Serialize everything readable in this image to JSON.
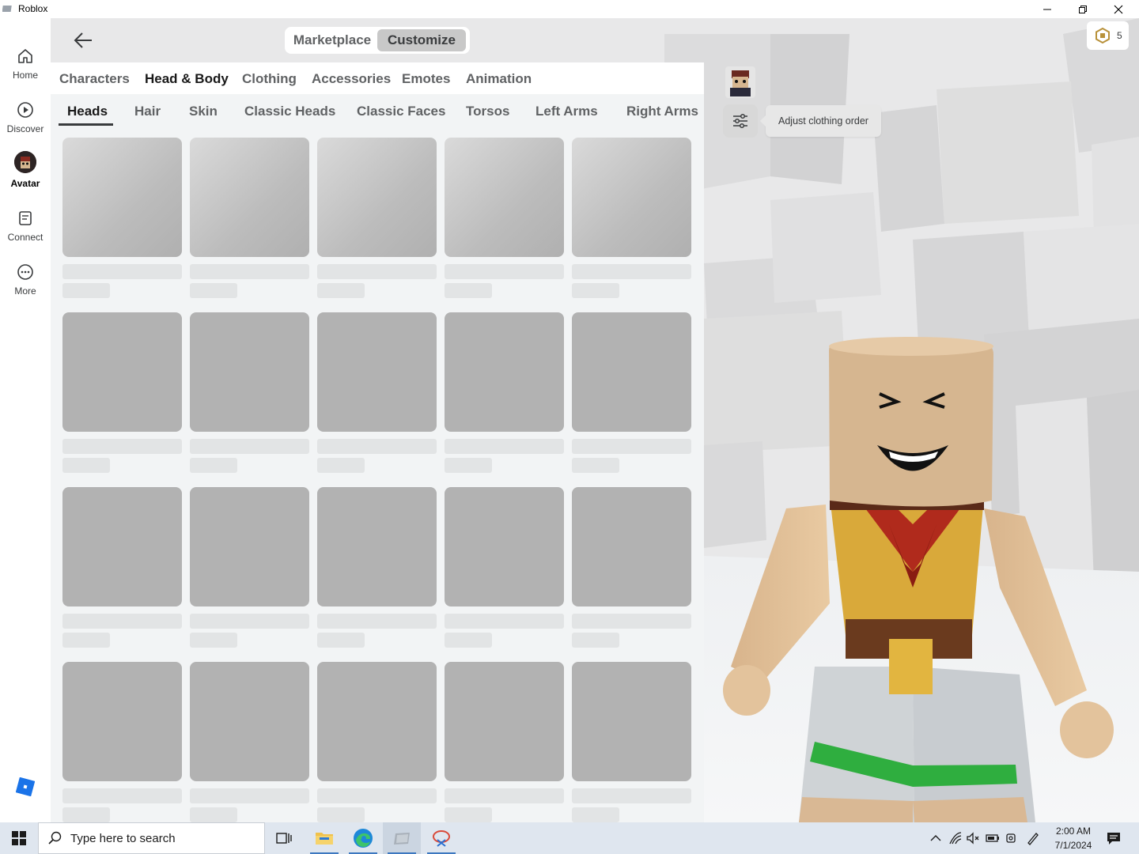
{
  "window": {
    "title": "Roblox"
  },
  "nav": {
    "items": [
      {
        "label": "Home",
        "icon": "home-icon"
      },
      {
        "label": "Discover",
        "icon": "play-icon"
      },
      {
        "label": "Avatar",
        "icon": "avatar-icon",
        "active": true
      },
      {
        "label": "Connect",
        "icon": "chat-icon"
      },
      {
        "label": "More",
        "icon": "more-icon"
      }
    ]
  },
  "header": {
    "segment": {
      "marketplace": "Marketplace",
      "customize": "Customize"
    }
  },
  "tabs": {
    "categories": [
      "Characters",
      "Head & Body",
      "Clothing",
      "Accessories",
      "Emotes",
      "Animation"
    ],
    "active_category": "Head & Body",
    "subcategories": [
      "Heads",
      "Hair",
      "Skin",
      "Classic Heads",
      "Classic Faces",
      "Torsos",
      "Left Arms",
      "Right Arms"
    ],
    "active_subcategory": "Heads"
  },
  "tooltip": {
    "text": "Adjust clothing order"
  },
  "robux": {
    "balance": "5"
  },
  "taskbar": {
    "search_placeholder": "Type here to search",
    "time": "2:00 AM",
    "date": "7/1/2024"
  },
  "colors": {
    "accent": "#393b3d",
    "panel": "#f2f4f5",
    "skeleton": "#b2b2b2",
    "taskbar": "#dfe6ef"
  }
}
